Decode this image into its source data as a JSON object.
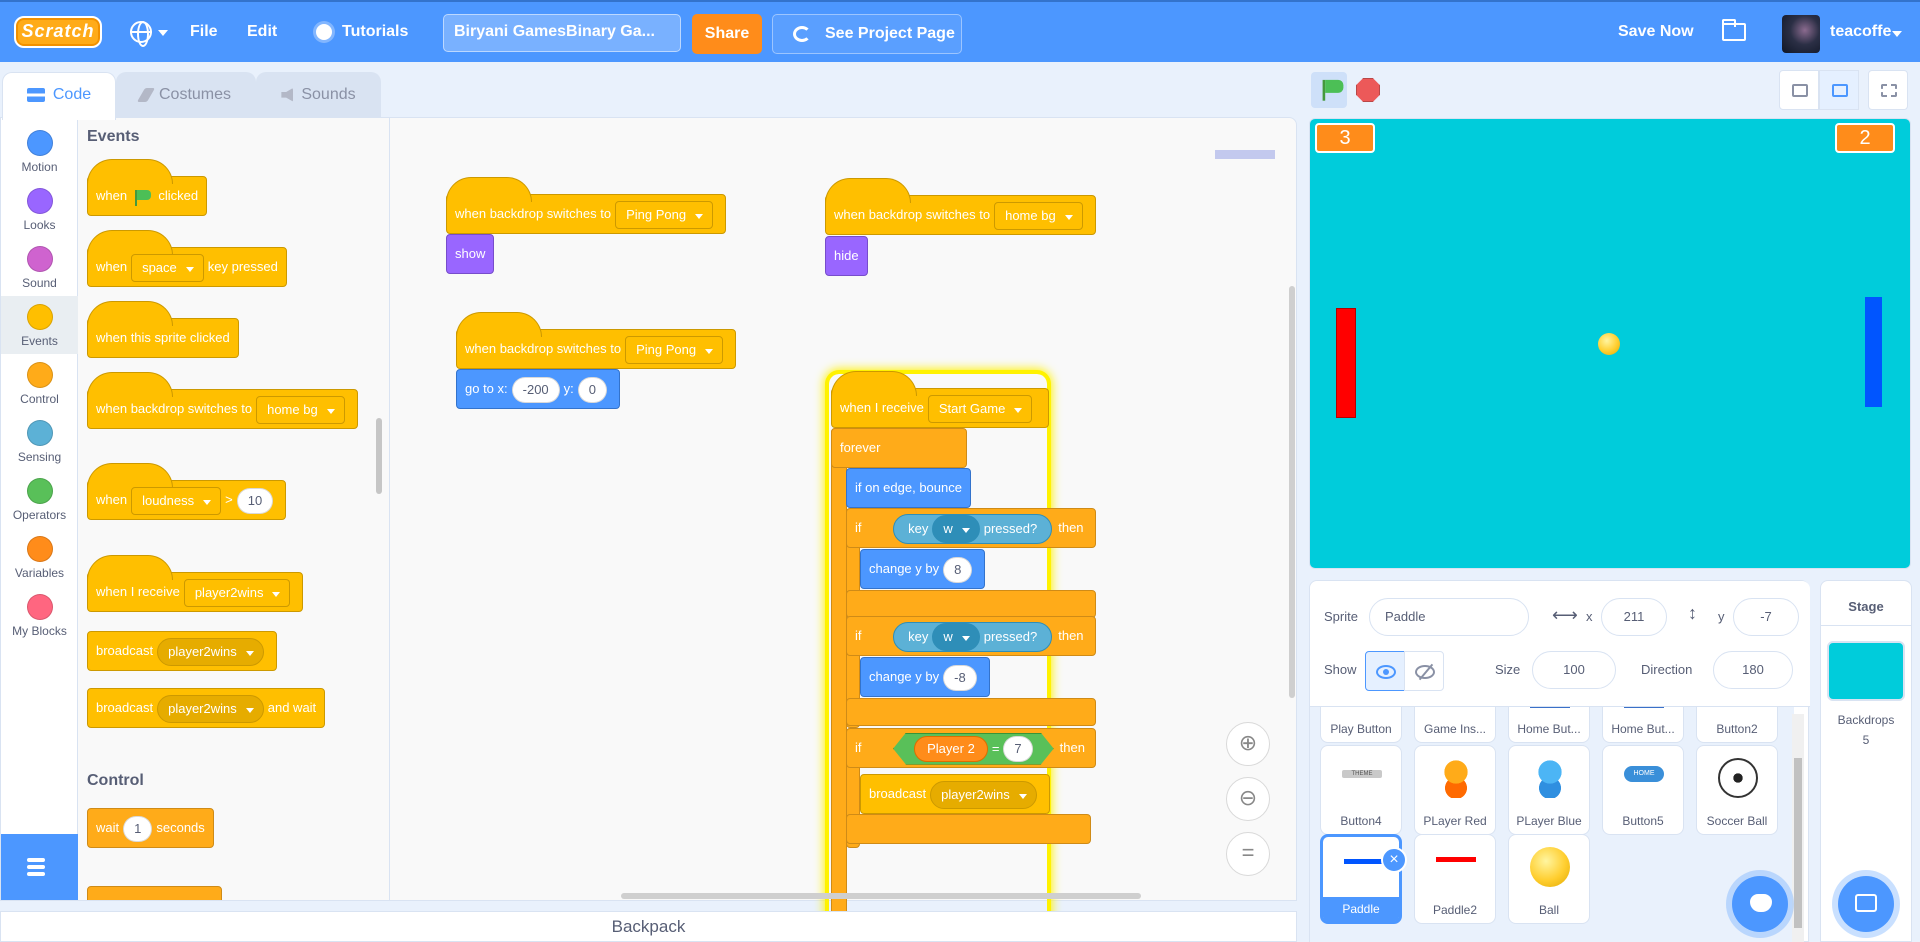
{
  "menu": {
    "logo": "Scratch",
    "file": "File",
    "edit": "Edit",
    "tutorials": "Tutorials",
    "project_title": "Biryani GamesBinary Ga...",
    "share": "Share",
    "see_project_page": "See Project Page",
    "save_now": "Save Now",
    "username": "teacoffe"
  },
  "tabs": {
    "code": "Code",
    "costumes": "Costumes",
    "sounds": "Sounds"
  },
  "categories": [
    {
      "label": "Motion",
      "color": "#4c97ff"
    },
    {
      "label": "Looks",
      "color": "#9966ff"
    },
    {
      "label": "Sound",
      "color": "#cf63cf"
    },
    {
      "label": "Events",
      "color": "#ffbf00"
    },
    {
      "label": "Control",
      "color": "#ffab19"
    },
    {
      "label": "Sensing",
      "color": "#5cb1d6"
    },
    {
      "label": "Operators",
      "color": "#59c059"
    },
    {
      "label": "Variables",
      "color": "#ff8c1a"
    },
    {
      "label": "My Blocks",
      "color": "#ff6680"
    }
  ],
  "palette": {
    "events_heading": "Events",
    "control_heading": "Control",
    "when": "when",
    "clicked": "clicked",
    "space": "space",
    "key_pressed": "key pressed",
    "sprite_clicked": "when this sprite clicked",
    "backdrop_switches": "when backdrop switches to",
    "home_bg": "home bg",
    "loudness": "loudness",
    "gt": ">",
    "ten": "10",
    "when_i_receive": "when I receive",
    "player2wins": "player2wins",
    "broadcast": "broadcast",
    "and_wait": "and wait",
    "wait": "wait",
    "one": "1",
    "seconds": "seconds"
  },
  "scripts": {
    "s1_hat": "when backdrop switches to",
    "s1_opt": "Ping Pong",
    "show": "show",
    "s2_hat": "when backdrop switches to",
    "s2_opt": "home bg",
    "hide": "hide",
    "s3_hat": "when backdrop switches to",
    "s3_opt": "Ping Pong",
    "go_to_x": "go to x:",
    "x_val": "-200",
    "y_lbl": "y:",
    "y_val": "0",
    "s4_hat": "when I receive",
    "s4_opt": "Start Game",
    "forever": "forever",
    "bounce": "if on edge, bounce",
    "if": "if",
    "key": "key",
    "w": "w",
    "pressed": "pressed?",
    "then": "then",
    "change_y_by": "change y by",
    "plus8": "8",
    "minus8": "-8",
    "player2": "Player 2",
    "eq": "=",
    "seven": "7",
    "broadcast": "broadcast",
    "bc_opt": "player2wins"
  },
  "stage": {
    "score_left": "3",
    "score_right": "2"
  },
  "sprite_info": {
    "sprite_label": "Sprite",
    "sprite_name": "Paddle",
    "x_label": "x",
    "x_value": "211",
    "y_label": "y",
    "y_value": "-7",
    "show_label": "Show",
    "size_label": "Size",
    "size_value": "100",
    "direction_label": "Direction",
    "direction_value": "180"
  },
  "sprites": [
    {
      "name": "Play Button"
    },
    {
      "name": "Game Ins..."
    },
    {
      "name": "Home But..."
    },
    {
      "name": "Home But..."
    },
    {
      "name": "Button2"
    },
    {
      "name": "Button4"
    },
    {
      "name": "PLayer Red"
    },
    {
      "name": "PLayer Blue"
    },
    {
      "name": "Button5"
    },
    {
      "name": "Soccer Ball"
    },
    {
      "name": "Paddle"
    },
    {
      "name": "Paddle2"
    },
    {
      "name": "Ball"
    }
  ],
  "thumb_labels": {
    "button4": "THEME",
    "button5": "HOME"
  },
  "stage_pane": {
    "title": "Stage",
    "backdrops_label": "Backdrops",
    "backdrops_count": "5"
  },
  "backpack": "Backpack"
}
